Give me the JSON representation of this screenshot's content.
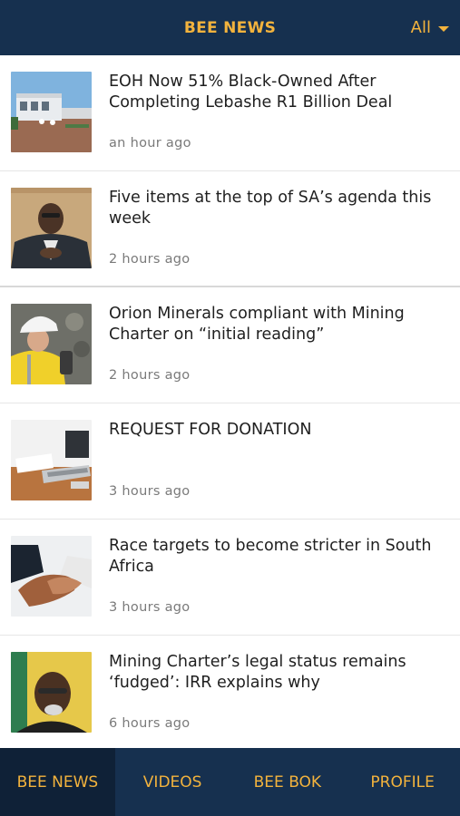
{
  "header": {
    "title": "BEE NEWS",
    "filter_label": "All",
    "filter_icon": "chevron-down-icon"
  },
  "articles": [
    {
      "title": "EOH Now 51% Black-Owned After Completing Lebashe R1 Billion Deal",
      "time": "an hour ago"
    },
    {
      "title": "Five items at the top of SA’s agenda this week",
      "time": "2 hours ago"
    },
    {
      "title": "Orion Minerals compliant with Mining Charter on “initial reading”",
      "time": "2 hours ago"
    },
    {
      "title": "REQUEST FOR DONATION",
      "time": "3 hours ago"
    },
    {
      "title": "Race targets to become stricter in South Africa",
      "time": "3 hours ago"
    },
    {
      "title": "Mining Charter’s legal status remains ‘fudged’: IRR explains why",
      "time": "6 hours ago"
    }
  ],
  "tabs": [
    {
      "label": "BEE NEWS",
      "active": true
    },
    {
      "label": "VIDEOS",
      "active": false
    },
    {
      "label": "BEE BOK",
      "active": false
    },
    {
      "label": "PROFILE",
      "active": false
    }
  ],
  "colors": {
    "bar_background": "#16304f",
    "accent": "#f3b33d",
    "active_tab": "#0f2137"
  }
}
